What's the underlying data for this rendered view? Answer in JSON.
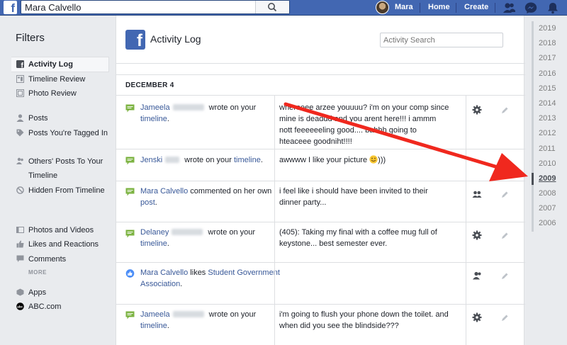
{
  "topbar": {
    "logo": "f",
    "search_value": "Mara Calvello",
    "user_name": "Mara",
    "home_label": "Home",
    "create_label": "Create"
  },
  "sidebar": {
    "title": "Filters",
    "items": [
      {
        "label": "Activity Log",
        "icon": "fb-icon"
      },
      {
        "label": "Timeline Review",
        "icon": "timeline-review-icon"
      },
      {
        "label": "Photo Review",
        "icon": "photo-review-icon"
      },
      {
        "label": "Posts",
        "icon": "person-icon"
      },
      {
        "label": "Posts You're Tagged In",
        "icon": "tag-icon"
      },
      {
        "label": "Others' Posts To Your Timeline",
        "icon": "people-icon"
      },
      {
        "label": "Hidden From Timeline",
        "icon": "hidden-icon"
      },
      {
        "label": "Photos and Videos",
        "icon": "photos-icon"
      },
      {
        "label": "Likes and Reactions",
        "icon": "like-icon"
      },
      {
        "label": "Comments",
        "icon": "comment-icon"
      },
      {
        "label": "Apps",
        "icon": "apps-icon"
      },
      {
        "label": "ABC.com",
        "icon": "abc-logo-icon"
      }
    ],
    "more_label": "MORE"
  },
  "main": {
    "logo": "f",
    "title": "Activity Log",
    "search_placeholder": "Activity Search",
    "date_header": "DECEMBER 4",
    "rows": [
      {
        "actor": "Jameela",
        "verb": " wrote on your",
        "target": "timeline",
        "after": ".",
        "content": "whereeee arzee youuuu? i'm on your comp since mine is deaddd and you arent here!!! i ammm nott feeeeeeling good.... bahhh going to hteaceee goodniht!!!!",
        "audience_icon": "gear-icon"
      },
      {
        "actor": "Jenski",
        "verb": " wrote on your",
        "target": "timeline",
        "after": ".",
        "content": "awwww I like your picture",
        "content_after": ")))",
        "audience_icon": "none"
      },
      {
        "actor": "Mara Calvello",
        "verb": " commented on her own",
        "target": "post",
        "after": ".",
        "content": "i feel like i should have been invited to their dinner party...",
        "audience_icon": "friends-icon"
      },
      {
        "actor": "Delaney",
        "verb": " wrote on your",
        "target": "timeline",
        "after": ".",
        "content": "(405): Taking my final with a coffee mug full of keystone... best semester ever.",
        "audience_icon": "gear-icon"
      },
      {
        "actor": "Mara Calvello",
        "verb": " likes ",
        "target": "Student Government Association",
        "after": ".",
        "content": "",
        "audience_icon": "friends-except-icon"
      },
      {
        "actor": "Jameela",
        "verb": " wrote on your",
        "target": "timeline",
        "after": ".",
        "content": "i'm going to flush your phone down the toilet. and when did you see the blindside???",
        "audience_icon": "gear-icon"
      }
    ]
  },
  "years": [
    "2019",
    "2018",
    "2017",
    "2016",
    "2015",
    "2014",
    "2013",
    "2012",
    "2011",
    "2010",
    "2009",
    "2008",
    "2007",
    "2006"
  ],
  "selected_year": "2009",
  "colors": {
    "brand": "#4267b2",
    "link": "#385898",
    "annotation_arrow": "#f0281e"
  }
}
